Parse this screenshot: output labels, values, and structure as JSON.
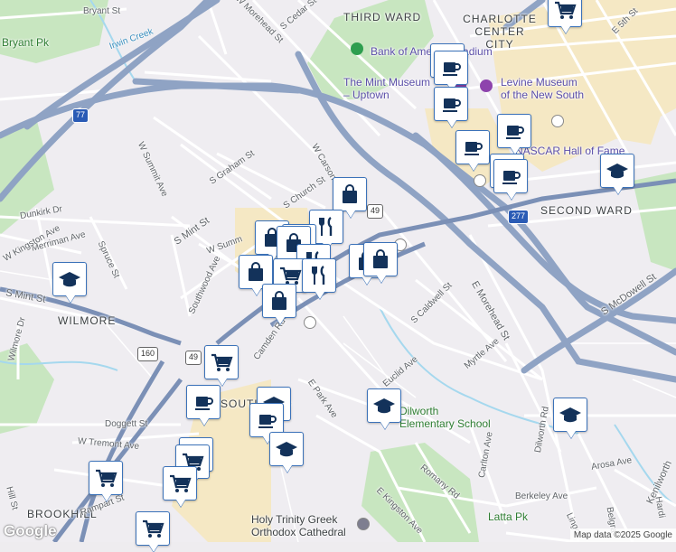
{
  "map": {
    "districts": [
      {
        "id": "third-ward",
        "text": "THIRD WARD"
      },
      {
        "id": "charlotte-center-city",
        "text": "CHARLOTTE\nCENTER CITY"
      },
      {
        "id": "second-ward",
        "text": "SECOND WARD"
      },
      {
        "id": "wilmore",
        "text": "WILMORE"
      },
      {
        "id": "brookhill",
        "text": "BROOKHILL"
      }
    ],
    "pois": [
      {
        "id": "bank-of-america-stadium",
        "text": "Bank of America Stadium"
      },
      {
        "id": "mint-museum",
        "text": "The Mint Museum\n– Uptown"
      },
      {
        "id": "levine-museum",
        "text": "Levine Museum\nof the New South"
      },
      {
        "id": "nascar-hall",
        "text": "NASCAR Hall of Fame"
      },
      {
        "id": "dilworth-elementary",
        "text": "Dilworth\nElementary School"
      },
      {
        "id": "holy-trinity",
        "text": "Holy Trinity Greek\nOrthodox Cathedral"
      },
      {
        "id": "south-end",
        "text": "SOUTH END"
      }
    ],
    "parks": [
      {
        "id": "bryant-pk",
        "text": "Bryant Pk"
      },
      {
        "id": "latta-pk",
        "text": "Latta Pk"
      }
    ],
    "streets": [
      {
        "id": "bryant-st",
        "text": "Bryant St"
      },
      {
        "id": "irwin-creek",
        "text": "Irwin Creek"
      },
      {
        "id": "w-morehead-st",
        "text": "W Morehead St"
      },
      {
        "id": "s-cedar-st",
        "text": "S Cedar St"
      },
      {
        "id": "e-5th-st",
        "text": "E 5th St"
      },
      {
        "id": "w-summit-ave",
        "text": "W Summit Ave"
      },
      {
        "id": "s-graham-st",
        "text": "S Graham St"
      },
      {
        "id": "w-carson",
        "text": "W Carson"
      },
      {
        "id": "s-church-st",
        "text": "S Church St"
      },
      {
        "id": "dunkirk-dr",
        "text": "Dunkirk Dr"
      },
      {
        "id": "merriman-ave",
        "text": "Merriman Ave"
      },
      {
        "id": "w-kingston-ave",
        "text": "W Kingston Ave"
      },
      {
        "id": "spruce-st",
        "text": "Spruce St"
      },
      {
        "id": "s-mint-st-1",
        "text": "S Mint St"
      },
      {
        "id": "s-mint-st-2",
        "text": "S Mint St"
      },
      {
        "id": "w-summ",
        "text": "W Summ"
      },
      {
        "id": "southwood-ave",
        "text": "Southwood Ave"
      },
      {
        "id": "s-caldwell-st",
        "text": "S Caldwell St"
      },
      {
        "id": "e-morehead-st",
        "text": "E Morehead St"
      },
      {
        "id": "s-mcdowell-st",
        "text": "S McDowell St"
      },
      {
        "id": "camden-rd",
        "text": "Camden Rd"
      },
      {
        "id": "myrtle-ave",
        "text": "Myrtle Ave"
      },
      {
        "id": "euclid-ave",
        "text": "Euclid Ave"
      },
      {
        "id": "e-park-ave",
        "text": "E Park Ave"
      },
      {
        "id": "doggett-st",
        "text": "Doggett St"
      },
      {
        "id": "w-tremont-ave",
        "text": "W Tremont Ave"
      },
      {
        "id": "rampart-st",
        "text": "Rampart St"
      },
      {
        "id": "romany-rd",
        "text": "Romany Rd"
      },
      {
        "id": "carlton-ave",
        "text": "Carlton Ave"
      },
      {
        "id": "dilworth-rd",
        "text": "Dilworth Rd"
      },
      {
        "id": "arosa-ave",
        "text": "Arosa Ave"
      },
      {
        "id": "berkeley-ave",
        "text": "Berkeley Ave"
      },
      {
        "id": "e-kingston-ave",
        "text": "E Kingston Ave"
      },
      {
        "id": "kenilworth",
        "text": "Kenilworth"
      },
      {
        "id": "wilmore-dr",
        "text": "Wilmore Dr"
      },
      {
        "id": "hill-st",
        "text": "Hill St"
      },
      {
        "id": "lingonberry",
        "text": "Lingo"
      },
      {
        "id": "belgrave",
        "text": "Belgra"
      },
      {
        "id": "harding",
        "text": "Hardi"
      }
    ],
    "shields": [
      {
        "id": "i277-a",
        "text": "277"
      },
      {
        "id": "i277-b",
        "text": "277"
      },
      {
        "id": "i77",
        "text": "77"
      },
      {
        "id": "nc49-a",
        "text": "49"
      },
      {
        "id": "nc49-b",
        "text": "49"
      },
      {
        "id": "us160",
        "text": "160"
      }
    ],
    "markers": [
      {
        "id": "m1",
        "icon": "shopping-cart"
      },
      {
        "id": "m2",
        "icon": "coffee-cup"
      },
      {
        "id": "m3",
        "icon": "coffee-cup"
      },
      {
        "id": "m4",
        "icon": "coffee-cup"
      },
      {
        "id": "m5",
        "icon": "coffee-cup"
      },
      {
        "id": "m6",
        "icon": "coffee-cup"
      },
      {
        "id": "m7",
        "icon": "coffee-cup"
      },
      {
        "id": "m8",
        "icon": "coffee-cup"
      },
      {
        "id": "m9",
        "icon": "graduation-cap"
      },
      {
        "id": "m10",
        "icon": "shopping-bag"
      },
      {
        "id": "m11",
        "icon": "fork-knife"
      },
      {
        "id": "m12",
        "icon": "shopping-bag"
      },
      {
        "id": "m13",
        "icon": "fork-knife"
      },
      {
        "id": "m14",
        "icon": "shopping-bag"
      },
      {
        "id": "m15",
        "icon": "fork-knife"
      },
      {
        "id": "m16",
        "icon": "shopping-bag"
      },
      {
        "id": "m17",
        "icon": "shopping-bag"
      },
      {
        "id": "m18",
        "icon": "shopping-cart"
      },
      {
        "id": "m19",
        "icon": "fork-knife"
      },
      {
        "id": "m20",
        "icon": "shopping-bag"
      },
      {
        "id": "m21",
        "icon": "shopping-bag"
      },
      {
        "id": "m22",
        "icon": "graduation-cap"
      },
      {
        "id": "m23",
        "icon": "shopping-cart"
      },
      {
        "id": "m24",
        "icon": "coffee-cup"
      },
      {
        "id": "m25",
        "icon": "graduation-cap"
      },
      {
        "id": "m26",
        "icon": "coffee-cup"
      },
      {
        "id": "m27",
        "icon": "graduation-cap"
      },
      {
        "id": "m28",
        "icon": "graduation-cap"
      },
      {
        "id": "m29",
        "icon": "graduation-cap"
      },
      {
        "id": "m30",
        "icon": "shopping-cart"
      },
      {
        "id": "m31",
        "icon": "shopping-cart"
      },
      {
        "id": "m32",
        "icon": "shopping-cart"
      },
      {
        "id": "m33",
        "icon": "shopping-cart"
      },
      {
        "id": "m34",
        "icon": "shopping-cart"
      }
    ],
    "attribution": "Map data ©2025 Google",
    "logo": "Google"
  },
  "colors": {
    "highway": "#8fa3c4",
    "road": "#ffffff",
    "park": "#c9e6c3",
    "water": "#9fd8ee",
    "pin_icon": "#13325a",
    "commercial": "#f6e9c3"
  }
}
